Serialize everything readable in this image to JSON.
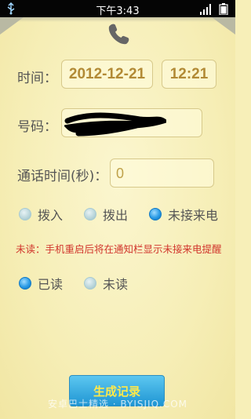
{
  "status_bar": {
    "time": "下午3:43"
  },
  "form": {
    "time_label": "时间：",
    "date_value": "2012-12-21",
    "time_value": "12:21",
    "number_label": "号码：",
    "duration_label": "通话时间(秒)：",
    "duration_value": "0"
  },
  "call_type": {
    "options": [
      "拨入",
      "拨出",
      "未接来电"
    ],
    "selected": "未接来电"
  },
  "note": "未读：手机重启后将在通知栏显示未接来电提醒",
  "read_status": {
    "options": [
      "已读",
      "未读"
    ],
    "selected": "已读"
  },
  "button": {
    "generate_label": "生成记录"
  },
  "watermark": "安卓巴士精选 · BYISJIQ.COM",
  "colors": {
    "background": "#f7efb8",
    "value_text": "#b28a35",
    "note_text": "#d1362d",
    "button": "#1f95d3",
    "button_text": "#ffe94a",
    "radio_selected": "#2a9be6"
  }
}
